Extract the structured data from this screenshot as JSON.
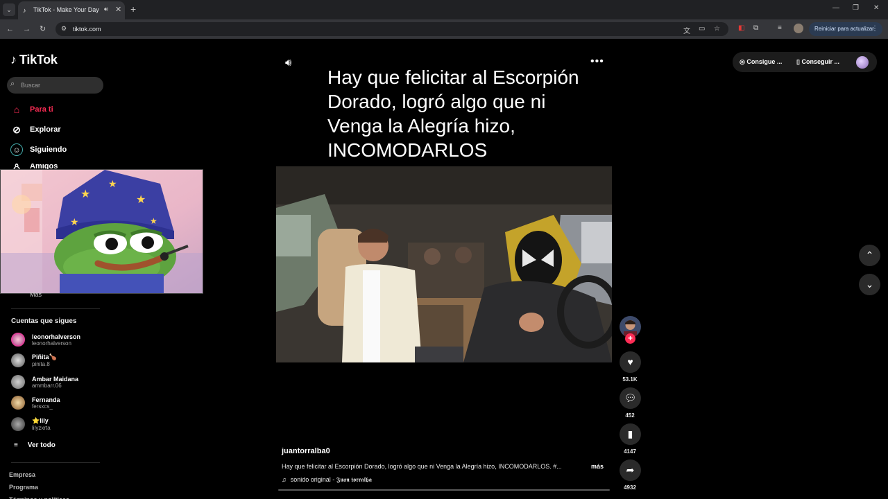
{
  "browser": {
    "tab_title": "TikTok - Make Your Day",
    "url": "tiktok.com",
    "relaunch_label": "Reiniciar para actualizar"
  },
  "sidebar": {
    "logo_text": "TikTok",
    "search_placeholder": "Buscar",
    "nav": [
      {
        "label": "Para ti",
        "icon": "home-icon"
      },
      {
        "label": "Explorar",
        "icon": "compass-icon"
      },
      {
        "label": "Siguiendo",
        "icon": "following-icon"
      },
      {
        "label": "Amigos",
        "icon": "friends-icon"
      }
    ],
    "more_label": "Más",
    "following_title": "Cuentas que sigues",
    "following": [
      {
        "name": "leonorhalverson",
        "handle": "leonorhalverson"
      },
      {
        "name": "Piñita🍗",
        "handle": "pinita.8"
      },
      {
        "name": "Ambar Maidana",
        "handle": "ammbarr.06"
      },
      {
        "name": "Fernanda",
        "handle": "fersxcs_"
      },
      {
        "name": "⭐lily",
        "handle": "lilyzxrta"
      }
    ],
    "see_all": "Ver todo",
    "footer": [
      "Empresa",
      "Programa",
      "Términos y políticas"
    ]
  },
  "video": {
    "caption": "Hay que felicitar al Escorpión Dorado, logró algo que ni Venga la Alegría hizo, INCOMODARLOS",
    "username": "juantorralba0",
    "description": "Hay que felicitar al Escorpión Dorado, logró algo que ni Venga la Alegría hizo, INCOMODARLOS. #...",
    "more": "más",
    "sound": "sonido original - 𝕵𝖚𝖆𝖓 𝖙𝖔𝖗𝖗𝖆𝖑𝖇𝖆"
  },
  "actions": {
    "likes": "53.1K",
    "comments": "452",
    "saves": "4147",
    "shares": "4932"
  },
  "top_right": {
    "coins_label": "Consigue ...",
    "app_label": "Conseguir ..."
  },
  "colors": {
    "accent": "#fe2c55",
    "background": "#000000"
  }
}
